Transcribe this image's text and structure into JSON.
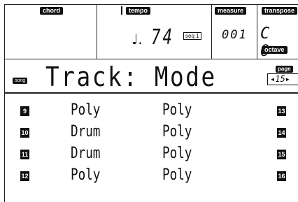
{
  "header": {
    "chord_label": "chord",
    "tempo_label": "tempo",
    "tempo_value": "74",
    "tempo_source": "seq 1",
    "measure_label": "measure",
    "measure_value": "001",
    "transpose_label": "transpose",
    "transpose_value": "C 0",
    "octave_label": "octave"
  },
  "page": {
    "song_badge": "song",
    "title": "Track: Mode",
    "page_label": "page",
    "page_value": "◂15▸"
  },
  "tracks": [
    {
      "left_num": "9",
      "left_mode": "Poly",
      "right_mode": "Poly",
      "right_num": "13"
    },
    {
      "left_num": "10",
      "left_mode": "Drum",
      "right_mode": "Poly",
      "right_num": "14"
    },
    {
      "left_num": "11",
      "left_mode": "Drum",
      "right_mode": "Poly",
      "right_num": "15"
    },
    {
      "left_num": "12",
      "left_mode": "Poly",
      "right_mode": "Poly",
      "right_num": "16"
    }
  ]
}
